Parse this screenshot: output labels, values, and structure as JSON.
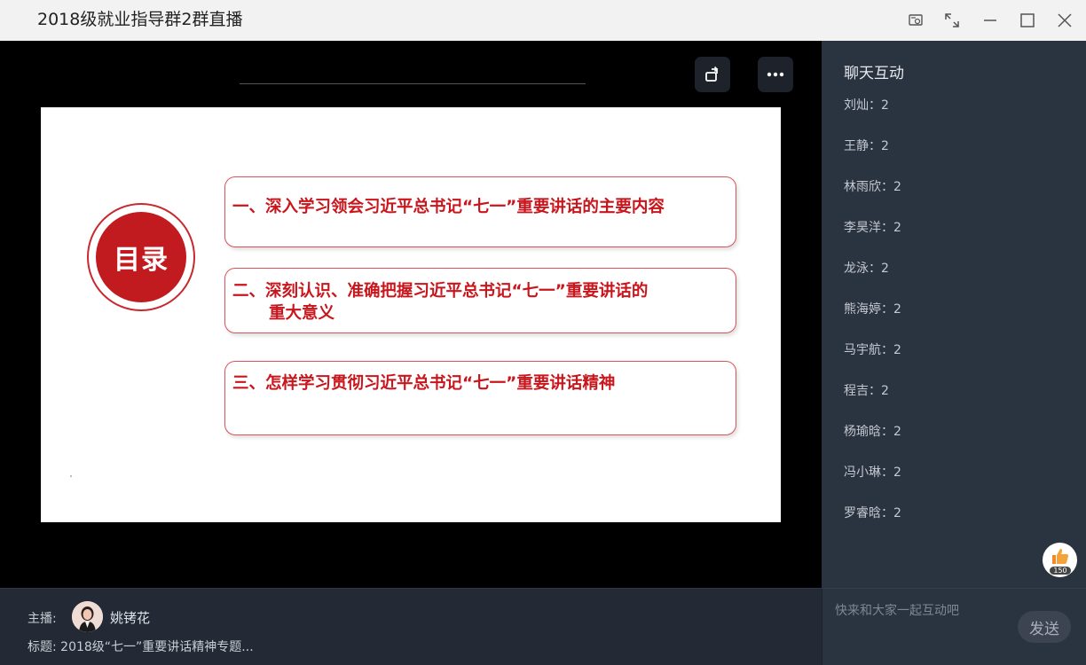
{
  "window": {
    "title": "2018级就业指导群2群直播",
    "controls": [
      "screen-share-icon",
      "fullscreen-icon",
      "minimize-icon",
      "maximize-icon",
      "close-icon"
    ]
  },
  "slide": {
    "seal_text": "目录",
    "items": [
      {
        "lines": [
          "一、深入学习领会习近平总书记“七一”重要讲话的主要内容"
        ]
      },
      {
        "lines": [
          "二、深刻认识、准确把握习近平总书记“七一”重要讲话的",
          "重大意义"
        ]
      },
      {
        "lines": [
          "三、怎样学习贯彻习近平总书记“七一”重要讲话精神"
        ]
      }
    ],
    "accent_color": "#c8161c"
  },
  "chat": {
    "title": "聊天互动",
    "messages": [
      {
        "text": "刘灿：2"
      },
      {
        "text": "王静：2"
      },
      {
        "text": "林雨欣：2"
      },
      {
        "text": "李昊洋：2"
      },
      {
        "text": "龙泳：2"
      },
      {
        "text": "熊海婷：2"
      },
      {
        "text": "马宇航：2"
      },
      {
        "text": "程吉：2"
      },
      {
        "text": "杨瑜晗：2"
      },
      {
        "text": "冯小琳：2"
      },
      {
        "text": "罗睿晗：2"
      }
    ],
    "like_count": "150",
    "input_placeholder": "快来和大家一起互动吧",
    "send_label": "发送"
  },
  "host": {
    "label": "主播:",
    "name": "姚铐花",
    "topic": "标题: 2018级“七一”重要讲话精神专题..."
  }
}
